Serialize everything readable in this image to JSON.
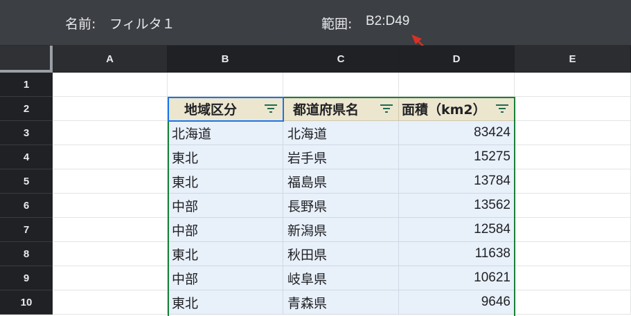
{
  "filter_bar": {
    "name_label": "名前:",
    "name_value": "フィルタ１",
    "range_label": "範囲:",
    "range_value": "B2:D49"
  },
  "columns": [
    "A",
    "B",
    "C",
    "D",
    "E"
  ],
  "rows": [
    "1",
    "2",
    "3",
    "4",
    "5",
    "6",
    "7",
    "8",
    "9",
    "10"
  ],
  "table": {
    "headers": [
      "地域区分",
      "都道府県名",
      "面積（km2）"
    ],
    "data": [
      [
        "北海道",
        "北海道",
        "83424"
      ],
      [
        "東北",
        "岩手県",
        "15275"
      ],
      [
        "東北",
        "福島県",
        "13784"
      ],
      [
        "中部",
        "長野県",
        "13562"
      ],
      [
        "中部",
        "新潟県",
        "12584"
      ],
      [
        "東北",
        "秋田県",
        "11638"
      ],
      [
        "中部",
        "岐阜県",
        "10621"
      ],
      [
        "東北",
        "青森県",
        "9646"
      ]
    ]
  },
  "colors": {
    "filter_bar_bg": "#3c3f43",
    "header_cell_bg": "#ece6cf",
    "data_cell_bg": "#e8f0fa",
    "range_border": "#188038",
    "active_cell_border": "#1a73e8",
    "annotation_arrow": "#d93025"
  },
  "icons": {
    "filter": "filter-lines-icon",
    "annotation": "arrow-annotation-icon"
  }
}
